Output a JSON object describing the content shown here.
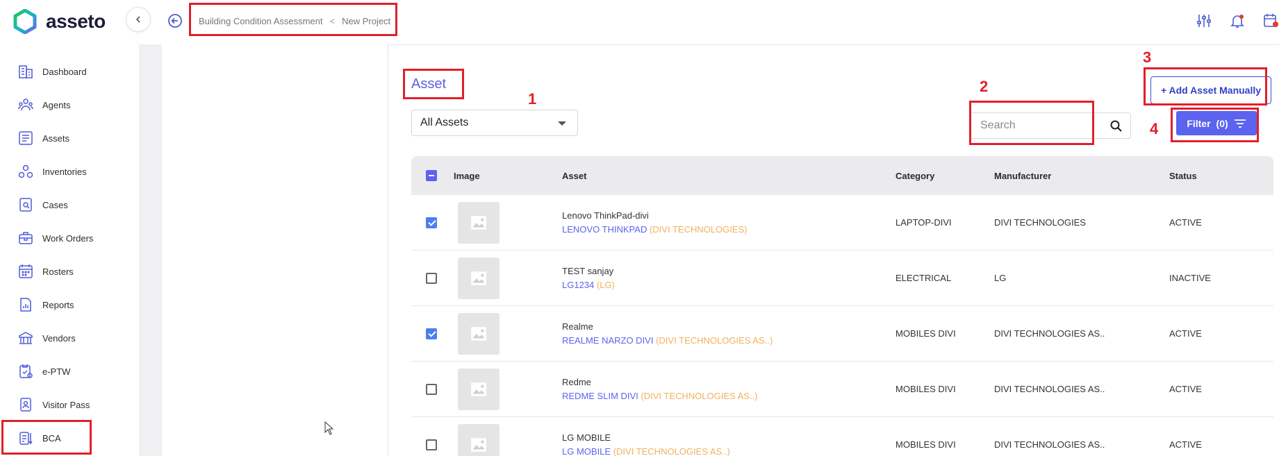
{
  "app": {
    "name": "asseto"
  },
  "sidebar": {
    "items": [
      {
        "label": "Dashboard",
        "icon": "dashboard-icon"
      },
      {
        "label": "Agents",
        "icon": "agents-icon"
      },
      {
        "label": "Assets",
        "icon": "assets-icon"
      },
      {
        "label": "Inventories",
        "icon": "inventories-icon"
      },
      {
        "label": "Cases",
        "icon": "cases-icon"
      },
      {
        "label": "Work Orders",
        "icon": "work-orders-icon"
      },
      {
        "label": "Rosters",
        "icon": "rosters-icon"
      },
      {
        "label": "Reports",
        "icon": "reports-icon"
      },
      {
        "label": "Vendors",
        "icon": "vendors-icon"
      },
      {
        "label": "e-PTW",
        "icon": "eptw-icon"
      },
      {
        "label": "Visitor Pass",
        "icon": "visitor-pass-icon"
      },
      {
        "label": "BCA",
        "icon": "bca-icon"
      }
    ]
  },
  "breadcrumb": {
    "parent": "Building Condition Assessment",
    "separator": "<",
    "current": "New Project"
  },
  "page": {
    "title": "Asset",
    "asset_filter": "All Assets",
    "search_placeholder": "Search",
    "add_button": "+ Add Asset Manually",
    "filter_button": "Filter",
    "filter_count": "(0)"
  },
  "annotations": {
    "n1": "1",
    "n2": "2",
    "n3": "3",
    "n4": "4"
  },
  "table": {
    "headers": {
      "image": "Image",
      "asset": "Asset",
      "category": "Category",
      "manufacturer": "Manufacturer",
      "status": "Status"
    },
    "rows": [
      {
        "checked": true,
        "name": "Lenovo ThinkPad-divi",
        "model": "LENOVO THINKPAD",
        "manufacturer_short": "(DIVI TECHNOLOGIES)",
        "category": "LAPTOP-DIVI",
        "manufacturer": "DIVI TECHNOLOGIES",
        "status": "ACTIVE"
      },
      {
        "checked": false,
        "name": "TEST sanjay",
        "model": "LG1234",
        "manufacturer_short": "(LG)",
        "category": "ELECTRICAL",
        "manufacturer": "LG",
        "status": "INACTIVE"
      },
      {
        "checked": true,
        "name": "Realme",
        "model": "REALME NARZO DIVI",
        "manufacturer_short": "(DIVI TECHNOLOGIES AS..)",
        "category": "MOBILES DIVI",
        "manufacturer": "DIVI TECHNOLOGIES AS..",
        "status": "ACTIVE"
      },
      {
        "checked": false,
        "name": "Redme",
        "model": "REDME SLIM DIVI",
        "manufacturer_short": "(DIVI TECHNOLOGIES AS..)",
        "category": "MOBILES DIVI",
        "manufacturer": "DIVI TECHNOLOGIES AS..",
        "status": "ACTIVE"
      },
      {
        "checked": false,
        "name": "LG MOBILE",
        "model": "LG MOBILE",
        "manufacturer_short": "(DIVI TECHNOLOGIES AS..)",
        "category": "MOBILES DIVI",
        "manufacturer": "DIVI TECHNOLOGIES AS..",
        "status": "ACTIVE"
      }
    ]
  },
  "colors": {
    "accent": "#5b63ef",
    "annotation_red": "#e0202a",
    "brand_teal": "#17c3b2"
  }
}
